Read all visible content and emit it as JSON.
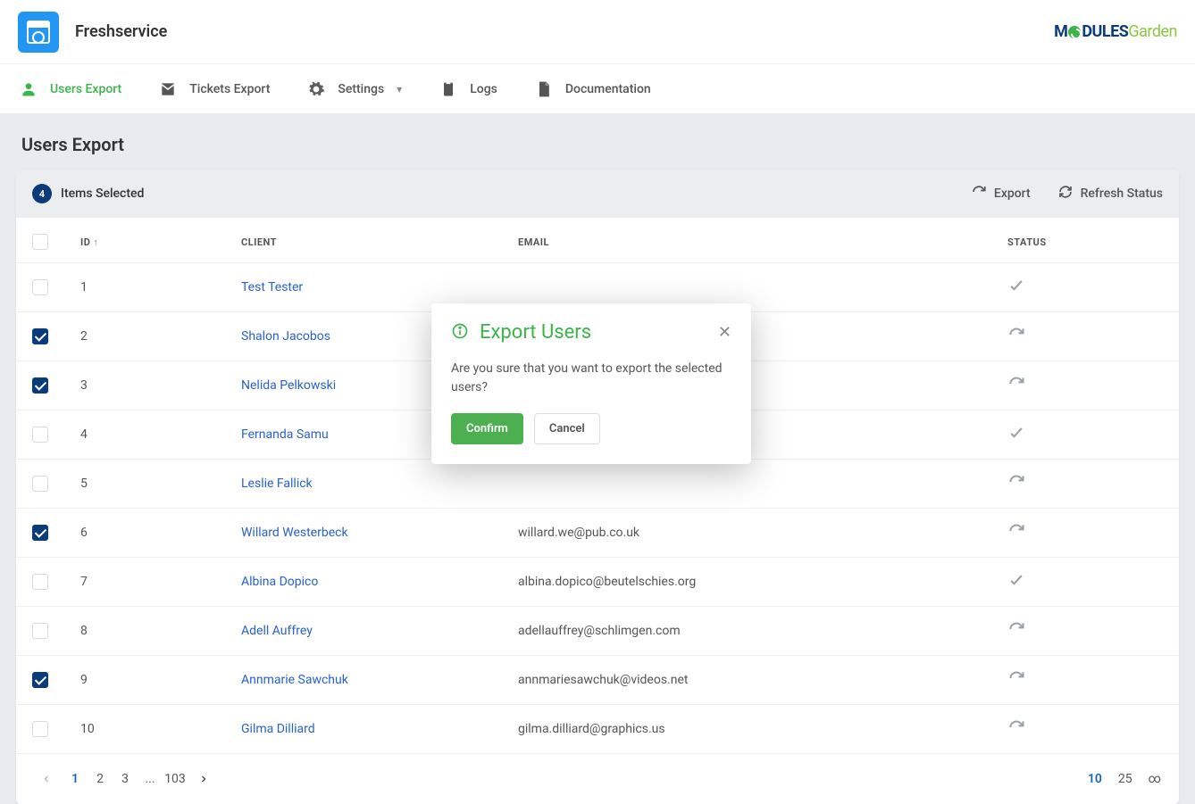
{
  "header": {
    "title": "Freshservice"
  },
  "nav": {
    "items": [
      {
        "label": "Users Export"
      },
      {
        "label": "Tickets Export"
      },
      {
        "label": "Settings"
      },
      {
        "label": "Logs"
      },
      {
        "label": "Documentation"
      }
    ]
  },
  "page": {
    "heading": "Users Export"
  },
  "toolbar": {
    "selected_count": "4",
    "selected_label": "Items Selected",
    "export_label": "Export",
    "refresh_label": "Refresh Status"
  },
  "table": {
    "cols": {
      "id": "ID",
      "client": "CLIENT",
      "email": "EMAIL",
      "status": "STATUS"
    },
    "rows": [
      {
        "id": "1",
        "client": "Test Tester",
        "email": "",
        "checked": false,
        "status": "done"
      },
      {
        "id": "2",
        "client": "Shalon Jacobos",
        "email": "",
        "checked": true,
        "status": "redo"
      },
      {
        "id": "3",
        "client": "Nelida Pelkowski",
        "email": "",
        "checked": true,
        "status": "redo"
      },
      {
        "id": "4",
        "client": "Fernanda Samu",
        "email": "",
        "checked": false,
        "status": "done"
      },
      {
        "id": "5",
        "client": "Leslie Fallick",
        "email": "",
        "checked": false,
        "status": "redo"
      },
      {
        "id": "6",
        "client": "Willard Westerbeck",
        "email": "willard.we@pub.co.uk",
        "checked": true,
        "status": "redo"
      },
      {
        "id": "7",
        "client": "Albina Dopico",
        "email": "albina.dopico@beutelschies.org",
        "checked": false,
        "status": "done"
      },
      {
        "id": "8",
        "client": "Adell Auffrey",
        "email": "adellauffrey@schlimgen.com",
        "checked": false,
        "status": "redo"
      },
      {
        "id": "9",
        "client": "Annmarie Sawchuk",
        "email": "annmariesawchuk@videos.net",
        "checked": true,
        "status": "redo"
      },
      {
        "id": "10",
        "client": "Gilma Dilliard",
        "email": "gilma.dilliard@graphics.us",
        "checked": false,
        "status": "redo"
      }
    ]
  },
  "pager": {
    "pages": [
      "1",
      "2",
      "3",
      "...",
      "103"
    ],
    "sizes": [
      "10",
      "25",
      "∞"
    ]
  },
  "modal": {
    "title": "Export Users",
    "body": "Are you sure that you want to export the selected users?",
    "confirm": "Confirm",
    "cancel": "Cancel"
  }
}
